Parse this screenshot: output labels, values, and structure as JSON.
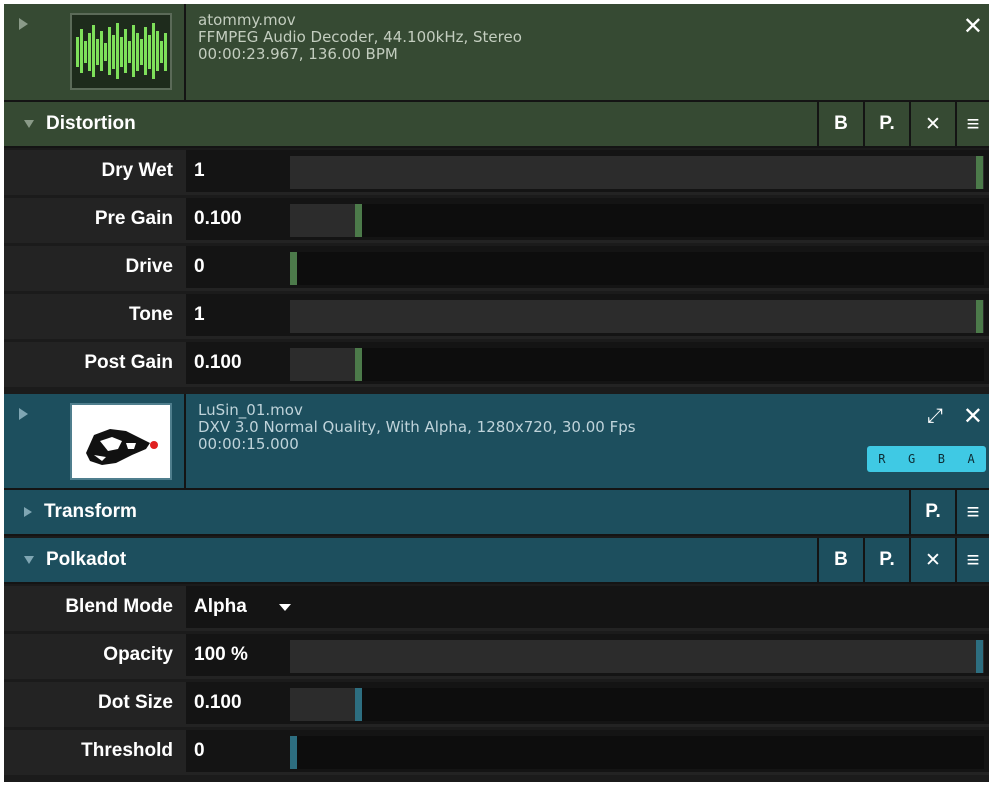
{
  "audio_clip": {
    "filename": "atommy.mov",
    "codec": "FFMPEG Audio Decoder, 44.100kHz, Stereo",
    "duration": "00:00:23.967, 136.00 BPM",
    "close_icon": "close-icon",
    "accent": "#4c7a4a"
  },
  "distortion": {
    "title": "Distortion",
    "buttons": {
      "b": "B",
      "p": "P.",
      "x": "✕",
      "menu": "≡"
    },
    "params": [
      {
        "label": "Dry Wet",
        "value": "1",
        "level": 1.0
      },
      {
        "label": "Pre Gain",
        "value": "0.100",
        "level": 0.1
      },
      {
        "label": "Drive",
        "value": "0",
        "level": 0.0
      },
      {
        "label": "Tone",
        "value": "1",
        "level": 1.0
      },
      {
        "label": "Post Gain",
        "value": "0.100",
        "level": 0.1
      }
    ]
  },
  "video_clip": {
    "filename": "LuSin_01.mov",
    "codec": "DXV 3.0 Normal Quality, With Alpha, 1280x720, 30.00 Fps",
    "duration": "00:00:15.000",
    "channels": [
      "R",
      "G",
      "B",
      "A"
    ],
    "expand_icon": "expand-icon",
    "close_icon": "close-icon",
    "accent": "#2d6e80"
  },
  "transform": {
    "title": "Transform",
    "buttons": {
      "p": "P.",
      "menu": "≡"
    }
  },
  "polkadot": {
    "title": "Polkadot",
    "buttons": {
      "b": "B",
      "p": "P.",
      "x": "✕",
      "menu": "≡"
    },
    "blend_mode": {
      "label": "Blend Mode",
      "value": "Alpha"
    },
    "params": [
      {
        "label": "Opacity",
        "value": "100 %",
        "level": 1.0
      },
      {
        "label": "Dot Size",
        "value": "0.100",
        "level": 0.1
      },
      {
        "label": "Threshold",
        "value": "0",
        "level": 0.0
      }
    ]
  }
}
